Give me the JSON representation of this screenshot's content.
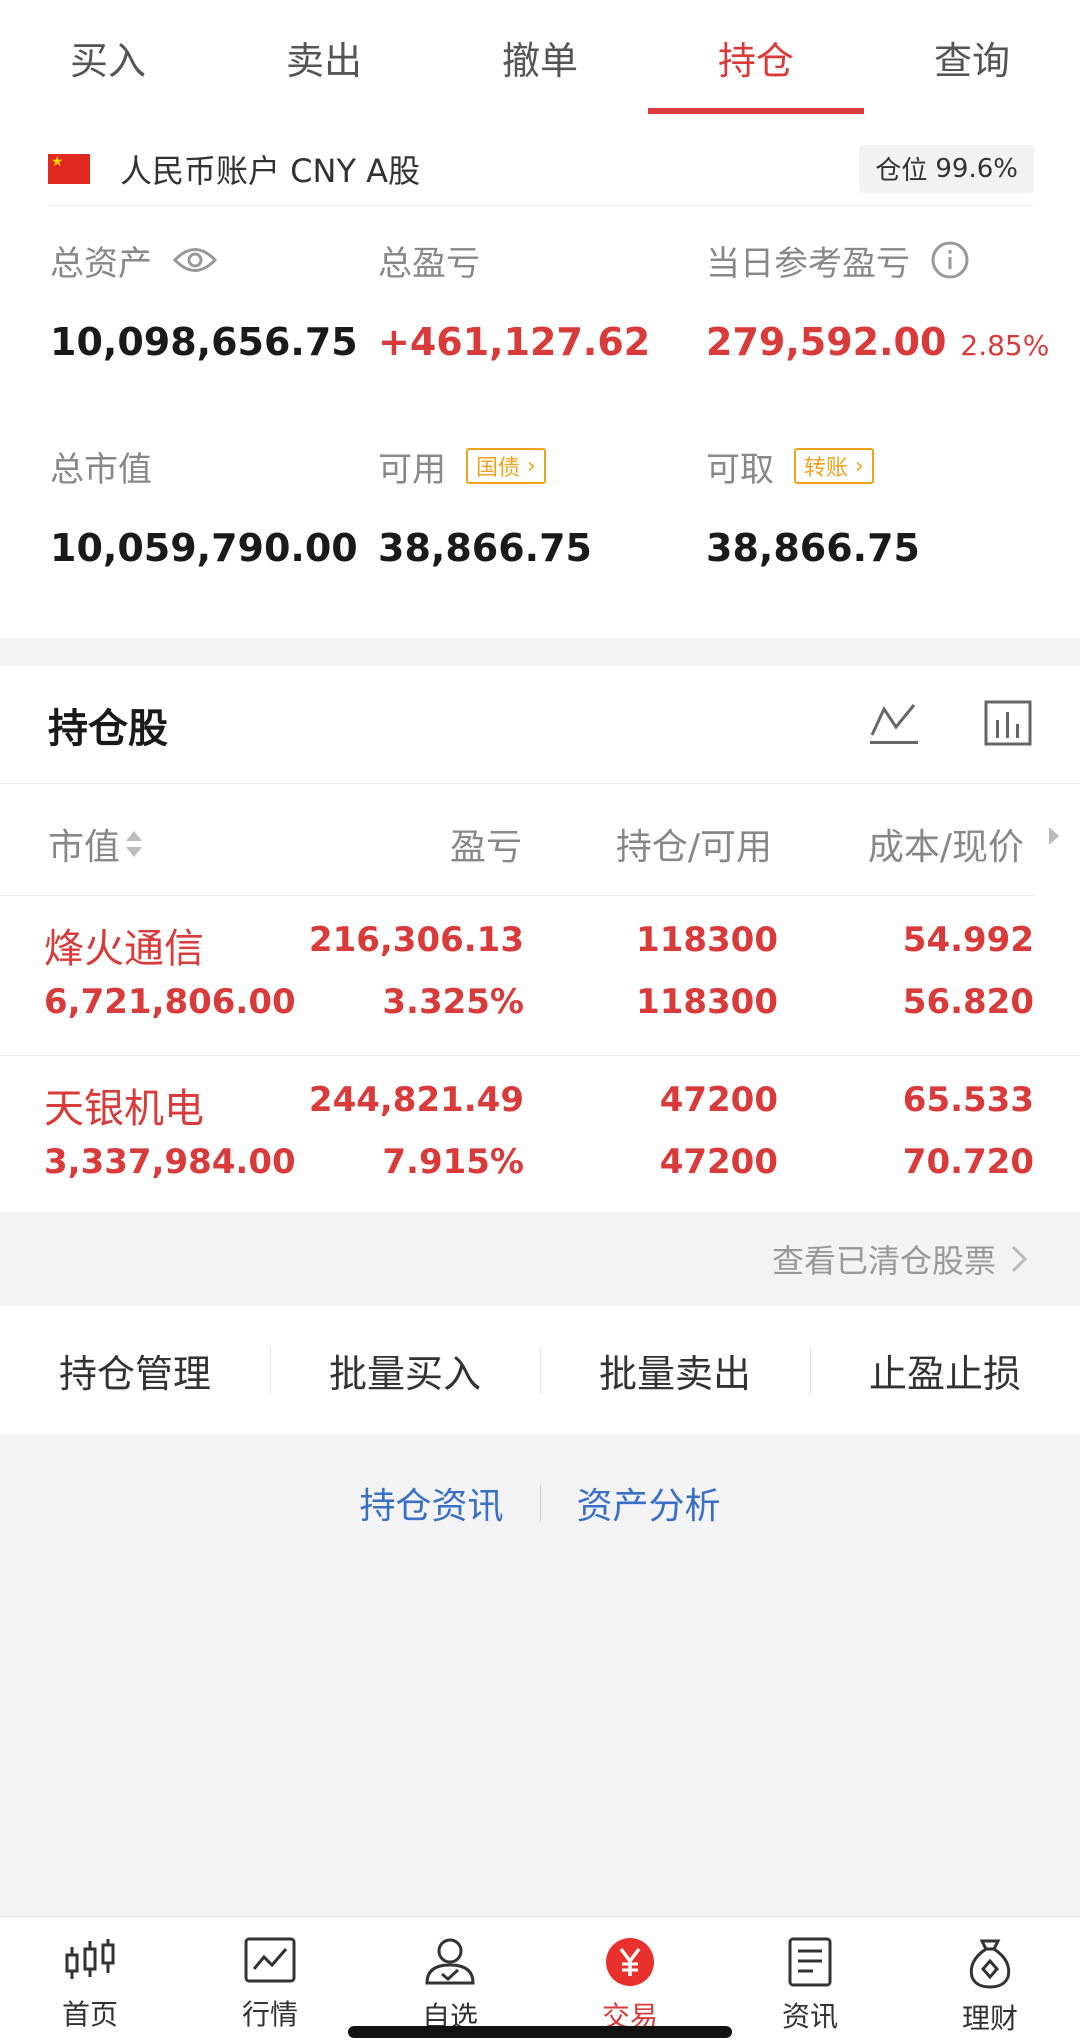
{
  "tabs": [
    {
      "label": "买入"
    },
    {
      "label": "卖出"
    },
    {
      "label": "撤单"
    },
    {
      "label": "持仓"
    },
    {
      "label": "查询"
    }
  ],
  "account": {
    "name": "人民币账户 CNY A股",
    "position_label": "仓位",
    "position_value": "99.6%",
    "total_assets_label": "总资产",
    "total_assets": "10,098,656.75",
    "total_pnl_label": "总盈亏",
    "total_pnl": "+461,127.62",
    "daily_pnl_label": "当日参考盈亏",
    "daily_pnl": "279,592.00",
    "daily_pnl_pct": "2.85%",
    "market_value_label": "总市值",
    "market_value": "10,059,790.00",
    "available_label": "可用",
    "available_tag": "国债",
    "available": "38,866.75",
    "withdrawable_label": "可取",
    "withdrawable_tag": "转账",
    "withdrawable": "38,866.75"
  },
  "holdings": {
    "title": "持仓股",
    "columns": [
      "市值",
      "盈亏",
      "持仓/可用",
      "成本/现价"
    ],
    "rows": [
      {
        "name": "烽火通信",
        "market_value": "6,721,806.00",
        "pnl": "216,306.13",
        "pnl_pct": "3.325%",
        "position": "118300",
        "available": "118300",
        "cost": "54.992",
        "price": "56.820"
      },
      {
        "name": "天银机电",
        "market_value": "3,337,984.00",
        "pnl": "244,821.49",
        "pnl_pct": "7.915%",
        "position": "47200",
        "available": "47200",
        "cost": "65.533",
        "price": "70.720"
      }
    ]
  },
  "cleared_link": "查看已清仓股票",
  "actions": [
    {
      "label": "持仓管理"
    },
    {
      "label": "批量买入"
    },
    {
      "label": "批量卖出"
    },
    {
      "label": "止盈止损"
    }
  ],
  "links": {
    "news": "持仓资讯",
    "analysis": "资产分析"
  },
  "nav": [
    {
      "label": "首页",
      "icon": "candlestick-icon"
    },
    {
      "label": "行情",
      "icon": "chart-icon"
    },
    {
      "label": "自选",
      "icon": "user-check-icon"
    },
    {
      "label": "交易",
      "icon": "yen-icon"
    },
    {
      "label": "资讯",
      "icon": "document-icon"
    },
    {
      "label": "理财",
      "icon": "money-bag-icon"
    }
  ],
  "colors": {
    "accent": "#d93a3a",
    "tag": "#f0a31b",
    "link": "#3a6fc6"
  }
}
